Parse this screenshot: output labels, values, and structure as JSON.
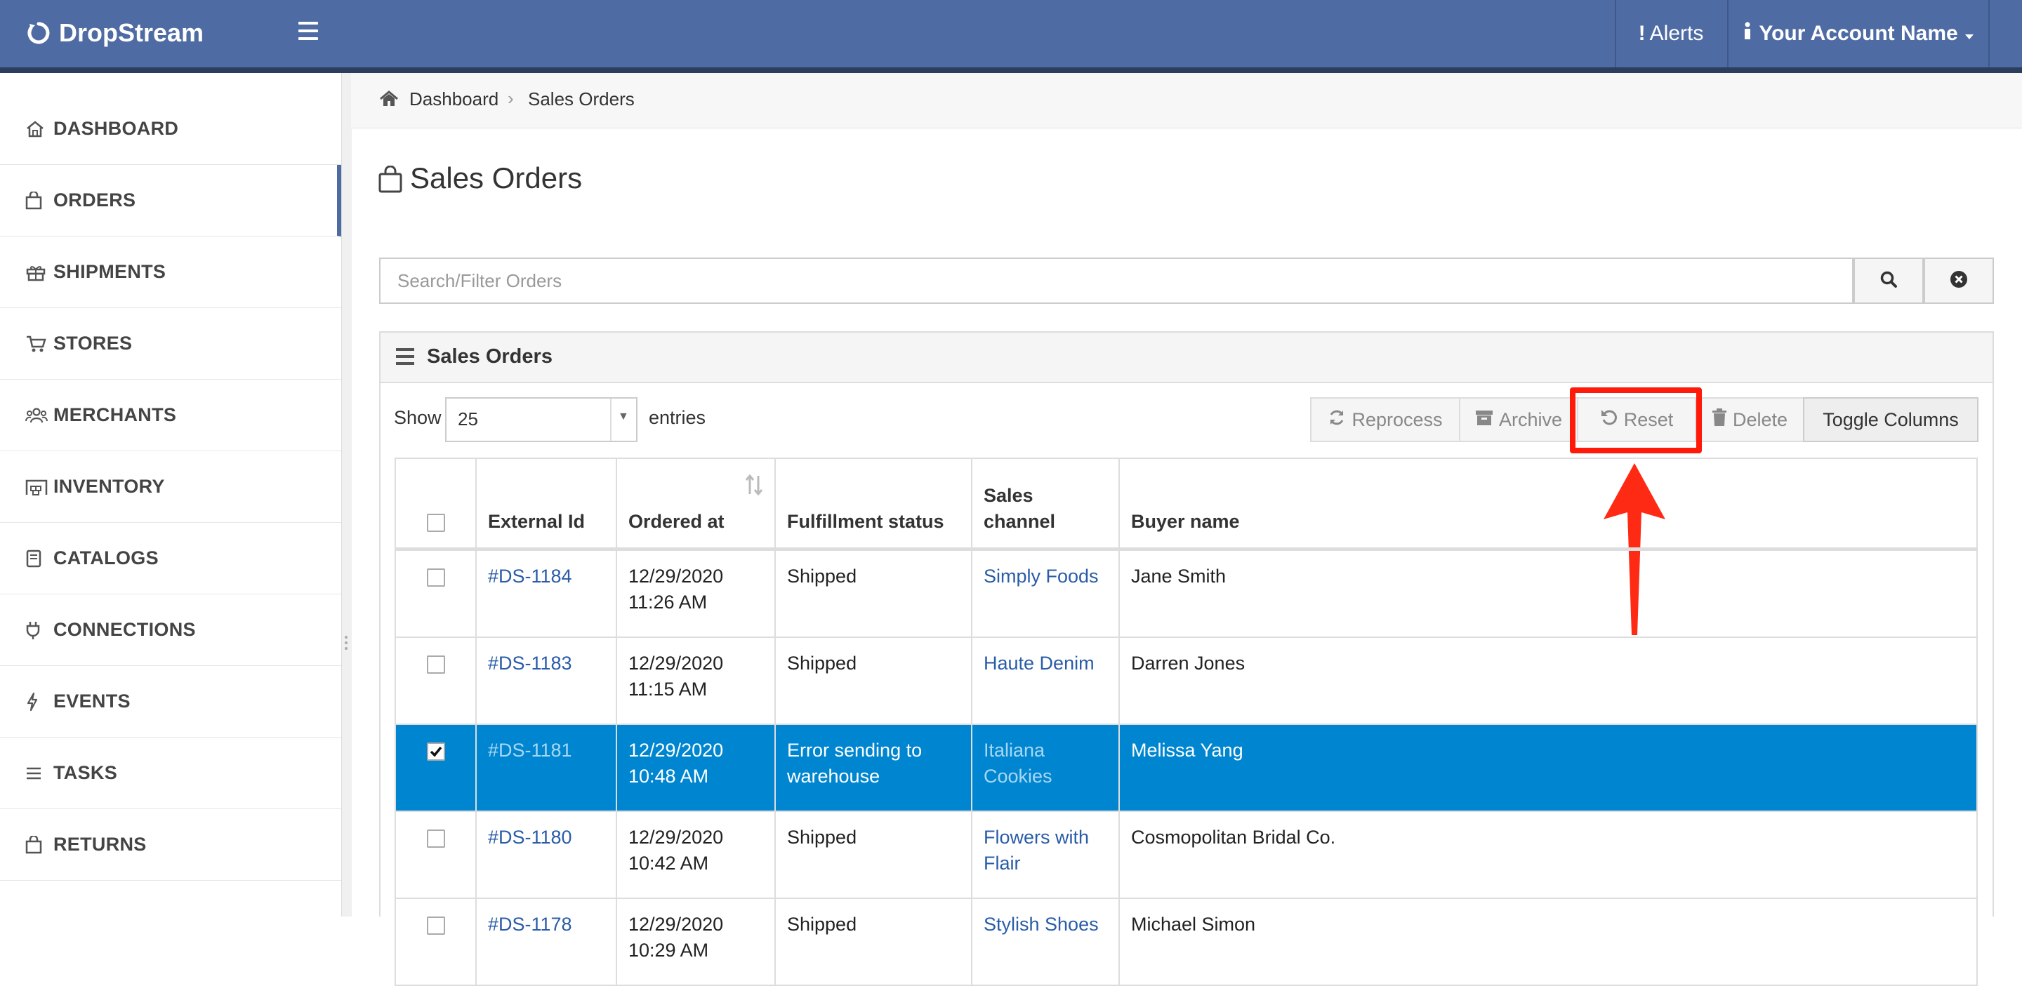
{
  "header": {
    "brand": "DropStream",
    "alerts_label": "Alerts",
    "account_label": "Your Account Name"
  },
  "sidebar": {
    "items": [
      {
        "label": "DASHBOARD",
        "icon": "home-icon"
      },
      {
        "label": "ORDERS",
        "icon": "shopping-bag-icon",
        "active": true
      },
      {
        "label": "SHIPMENTS",
        "icon": "gift-icon"
      },
      {
        "label": "STORES",
        "icon": "cart-icon"
      },
      {
        "label": "MERCHANTS",
        "icon": "users-icon"
      },
      {
        "label": "INVENTORY",
        "icon": "warehouse-icon"
      },
      {
        "label": "CATALOGS",
        "icon": "book-icon"
      },
      {
        "label": "CONNECTIONS",
        "icon": "plug-icon"
      },
      {
        "label": "EVENTS",
        "icon": "bolt-icon"
      },
      {
        "label": "TASKS",
        "icon": "list-icon"
      },
      {
        "label": "RETURNS",
        "icon": "shopping-bag-icon"
      }
    ]
  },
  "breadcrumb": {
    "home": "Dashboard",
    "current": "Sales Orders"
  },
  "page": {
    "title": "Sales Orders"
  },
  "search": {
    "placeholder": "Search/Filter Orders",
    "value": ""
  },
  "panel": {
    "title": "Sales Orders",
    "show_label": "Show",
    "entries_value": "25",
    "entries_label": "entries",
    "buttons": {
      "reprocess": "Reprocess",
      "archive": "Archive",
      "reset": "Reset",
      "delete": "Delete",
      "toggle_columns": "Toggle Columns"
    }
  },
  "table": {
    "columns": {
      "external_id": "External Id",
      "ordered_at": "Ordered at",
      "fulfillment_status": "Fulfillment status",
      "sales_channel": "Sales channel",
      "buyer_name": "Buyer name"
    },
    "rows": [
      {
        "id": "#DS-1184",
        "date": "12/29/2020",
        "time": "11:26 AM",
        "status": "Shipped",
        "channel": "Simply Foods",
        "buyer": "Jane Smith",
        "selected": false
      },
      {
        "id": "#DS-1183",
        "date": "12/29/2020",
        "time": "11:15 AM",
        "status": "Shipped",
        "channel": "Haute Denim",
        "buyer": "Darren Jones",
        "selected": false
      },
      {
        "id": "#DS-1181",
        "date": "12/29/2020",
        "time": "10:48 AM",
        "status": "Error sending to warehouse",
        "channel": "Italiana Cookies",
        "buyer": "Melissa Yang",
        "selected": true
      },
      {
        "id": "#DS-1180",
        "date": "12/29/2020",
        "time": "10:42 AM",
        "status": "Shipped",
        "channel": "Flowers with Flair",
        "buyer": "Cosmopolitan Bridal Co.",
        "selected": false
      },
      {
        "id": "#DS-1178",
        "date": "12/29/2020",
        "time": "10:29 AM",
        "status": "Shipped",
        "channel": "Stylish Shoes",
        "buyer": "Michael Simon",
        "selected": false
      }
    ]
  },
  "colors": {
    "header_bg": "#4f6ba4",
    "selected_row": "#0086d1",
    "link": "#2a5ca8",
    "highlight": "#ff1a0a"
  }
}
